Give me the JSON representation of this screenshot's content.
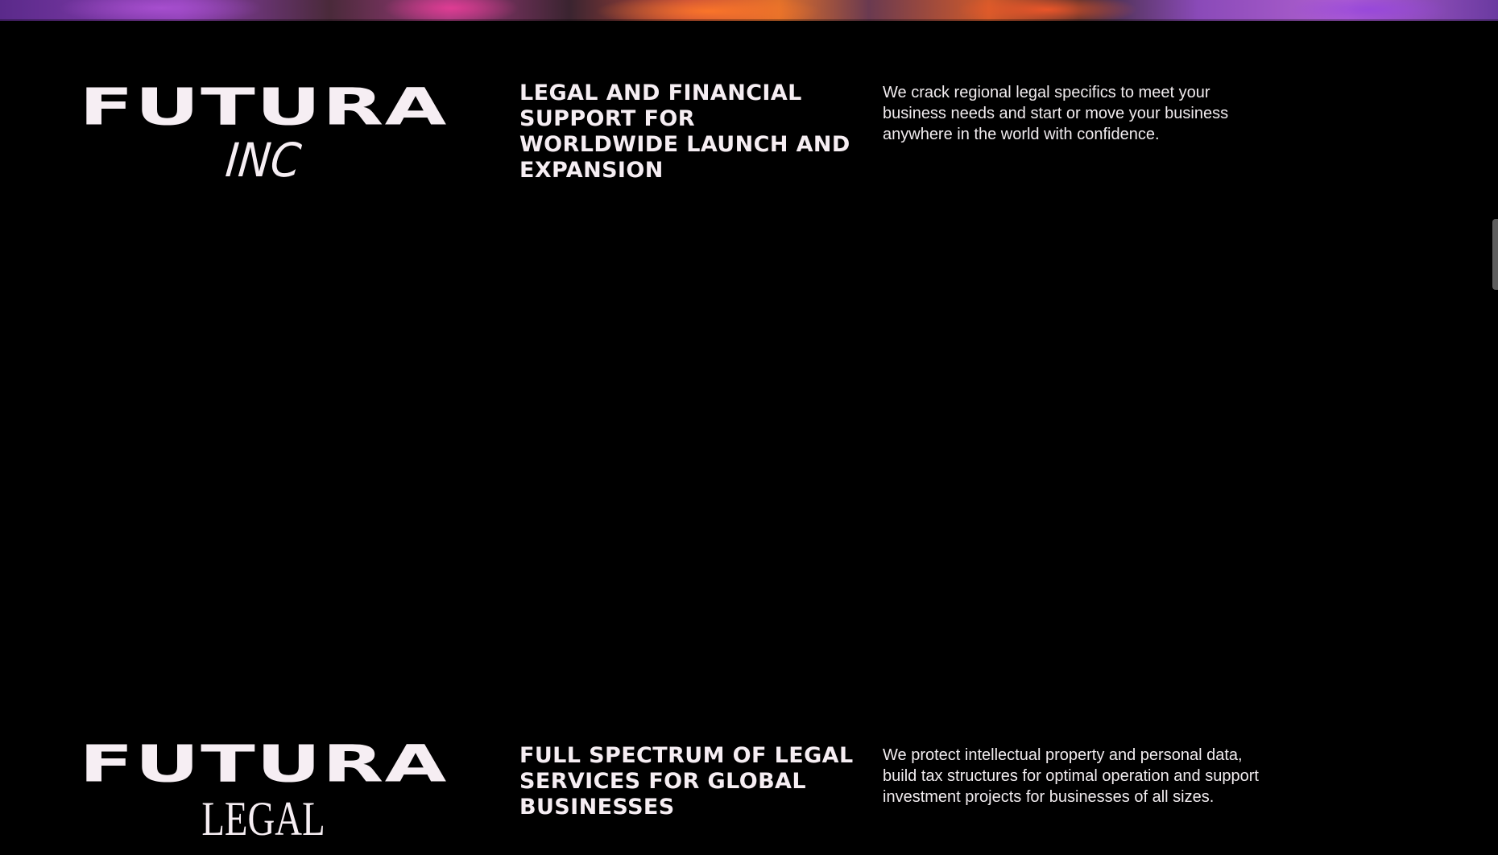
{
  "sections": [
    {
      "logo": {
        "main": "FUTURA",
        "sub": "INC"
      },
      "heading": "LEGAL AND FINANCIAL SUPPORT FOR WORLDWIDE LAUNCH AND EXPANSION",
      "description": "We crack regional legal specifics to meet your business needs and start or move your business anywhere in the world with confidence."
    },
    {
      "logo": {
        "main": "FUTURA",
        "sub": "LEGAL"
      },
      "heading": "FULL SPECTRUM OF LEGAL SERVICES FOR GLOBAL BUSINESSES",
      "description": "We protect intellectual property and personal data, build tax structures for optimal operation and support investment projects for businesses of all sizes."
    }
  ],
  "colors": {
    "background": "#000000",
    "text": "#f6eef3",
    "scrollbar": "#5e5e5e"
  }
}
